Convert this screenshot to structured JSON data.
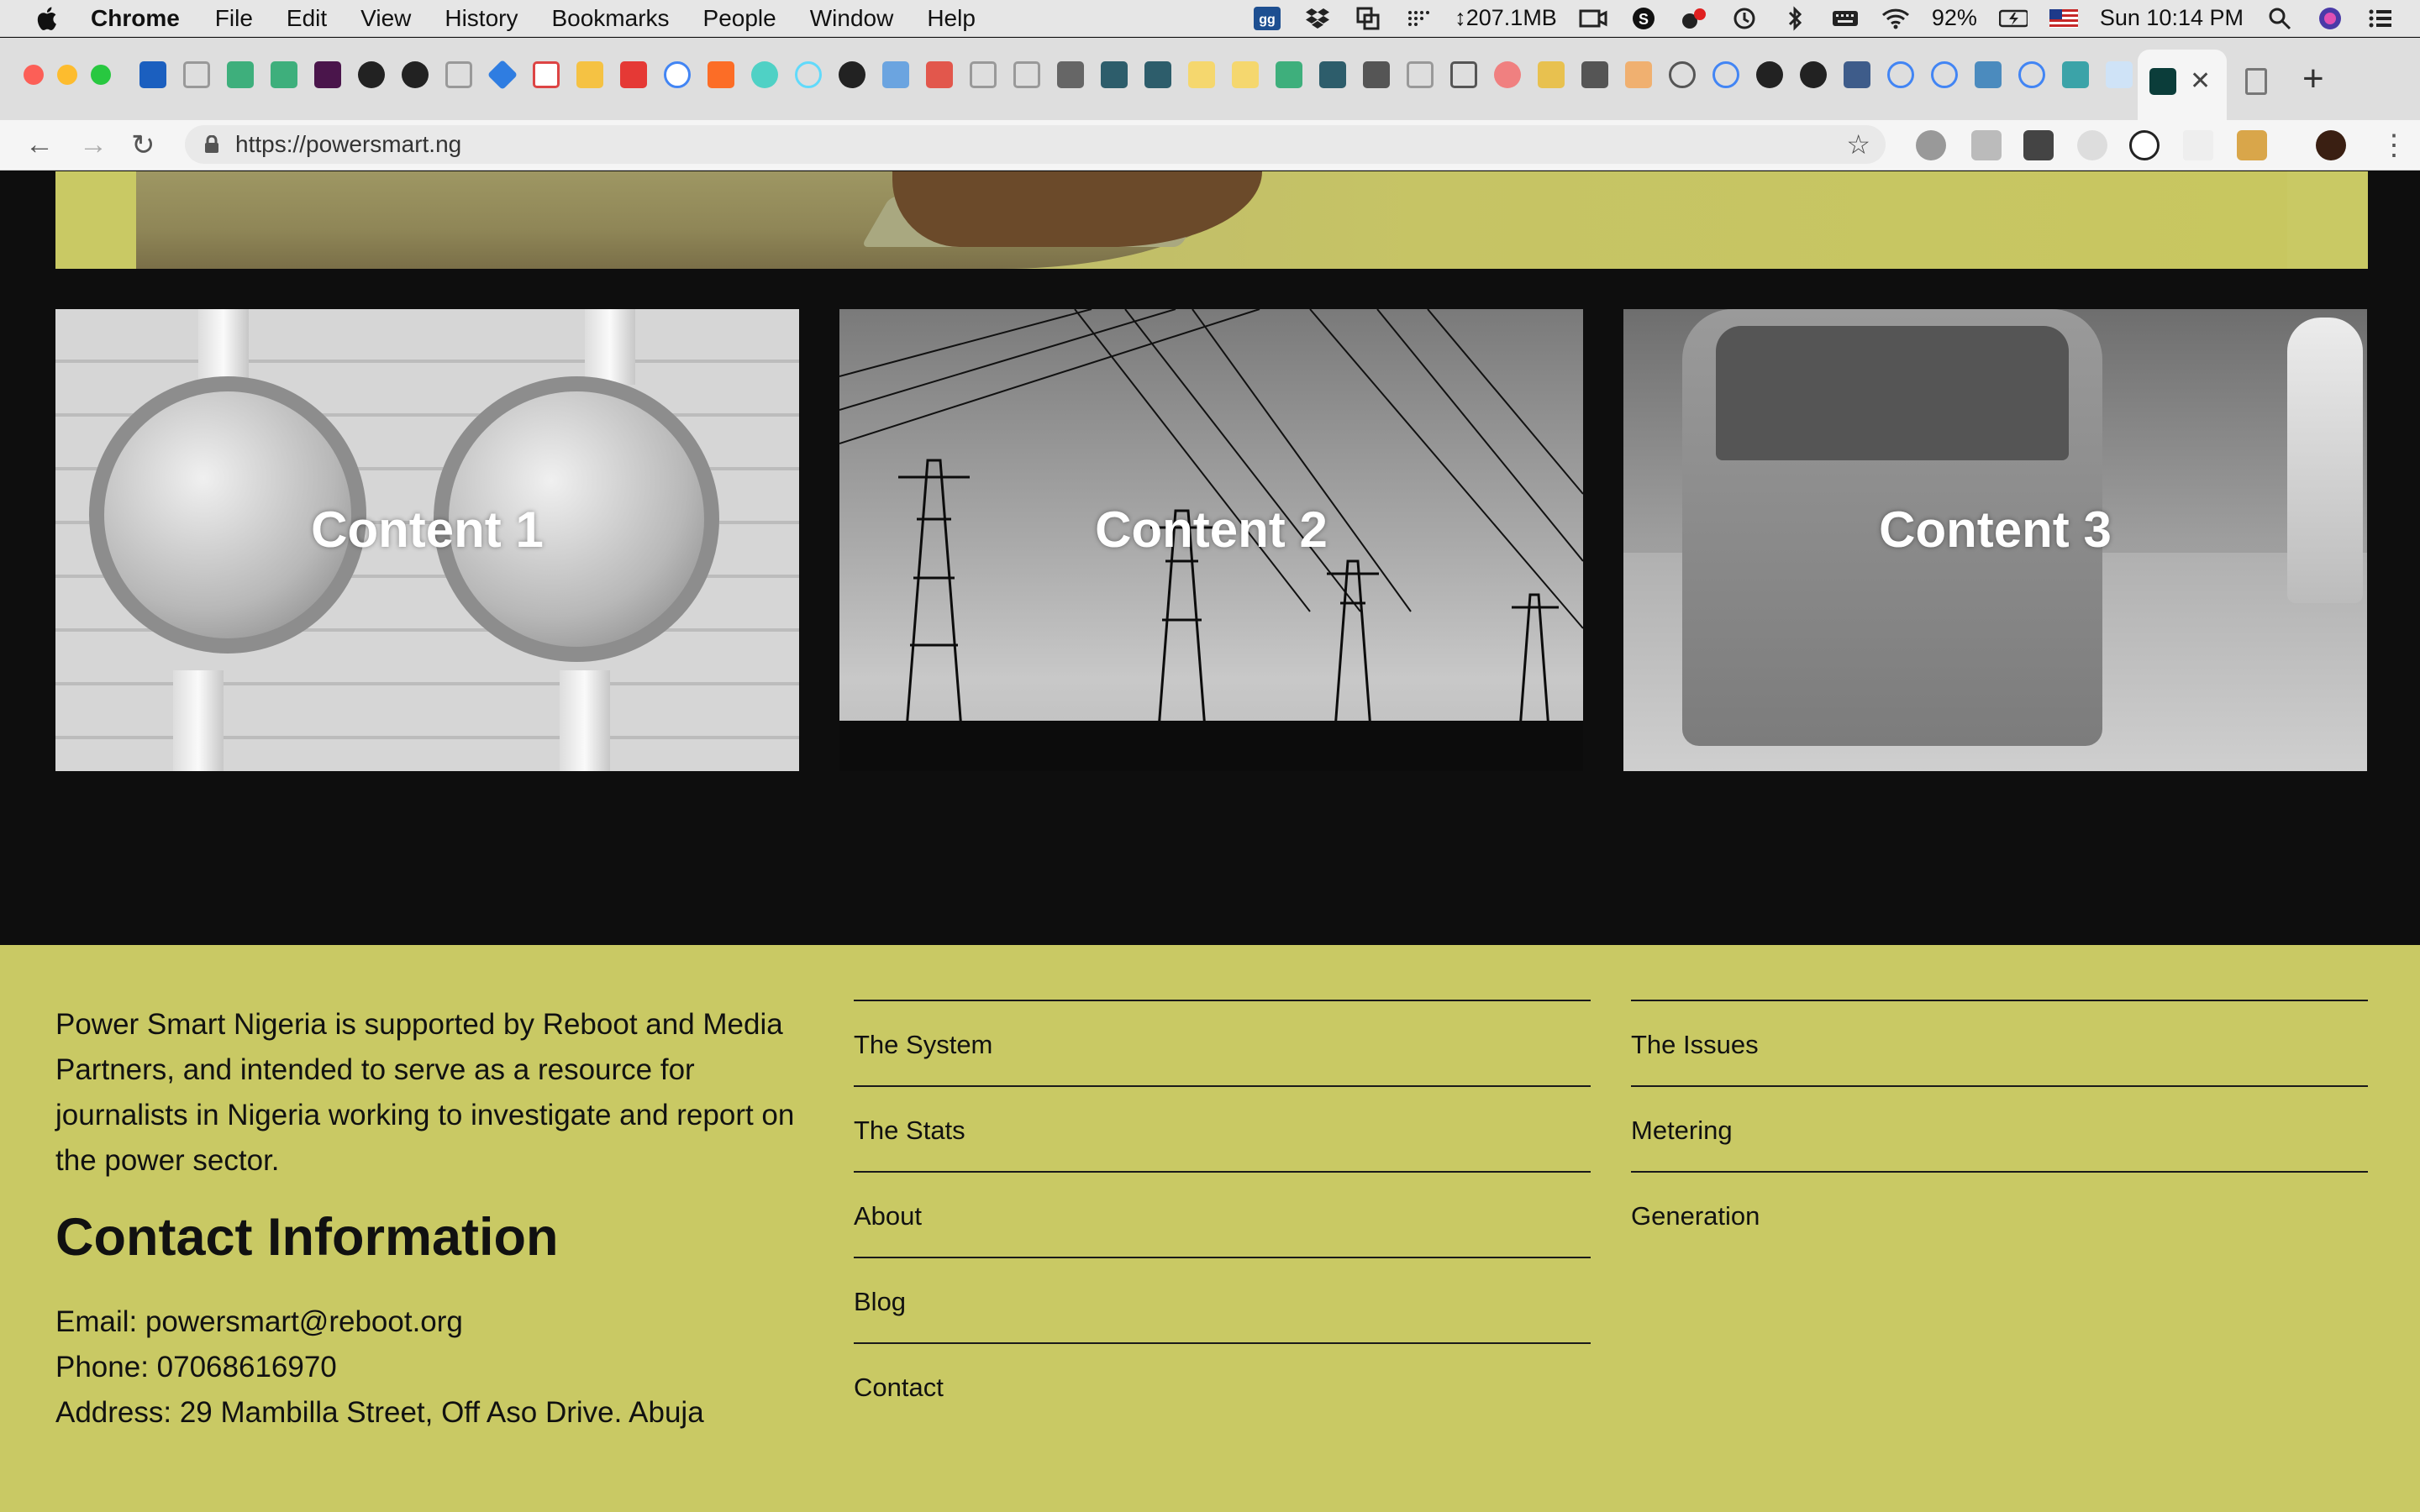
{
  "menubar": {
    "app": "Chrome",
    "menus": [
      "File",
      "Edit",
      "View",
      "History",
      "Bookmarks",
      "People",
      "Window",
      "Help"
    ],
    "memory": "↕207.1MB",
    "battery": "92%",
    "datetime": "Sun 10:14 PM"
  },
  "browser": {
    "url": "https://powersmart.ng",
    "icons": [
      "back-icon",
      "forward-icon",
      "reload-icon",
      "lock-icon",
      "star-icon",
      "close-tab-icon",
      "new-tab-icon",
      "menu-icon"
    ]
  },
  "cards": [
    {
      "caption": "Content 1"
    },
    {
      "caption": "Content 2"
    },
    {
      "caption": "Content 3"
    }
  ],
  "footer": {
    "about": "Power Smart Nigeria is supported by Reboot and Media Partners, and intended to serve as a resource for journalists in Nigeria working to investigate and report on the power sector.",
    "contact_heading": "Contact Information",
    "email": "Email: powersmart@reboot.org",
    "phone": "Phone: 07068616970",
    "address": "Address: 29 Mambilla Street, Off Aso Drive. Abuja",
    "col1_links": [
      "The System",
      "The Stats",
      "About",
      "Blog",
      "Contact"
    ],
    "col2_links": [
      "The Issues",
      "Metering",
      "Generation"
    ]
  },
  "colors": {
    "footer_bg": "#c9c964",
    "page_bg": "#0e0e0e",
    "text": "#111111"
  }
}
